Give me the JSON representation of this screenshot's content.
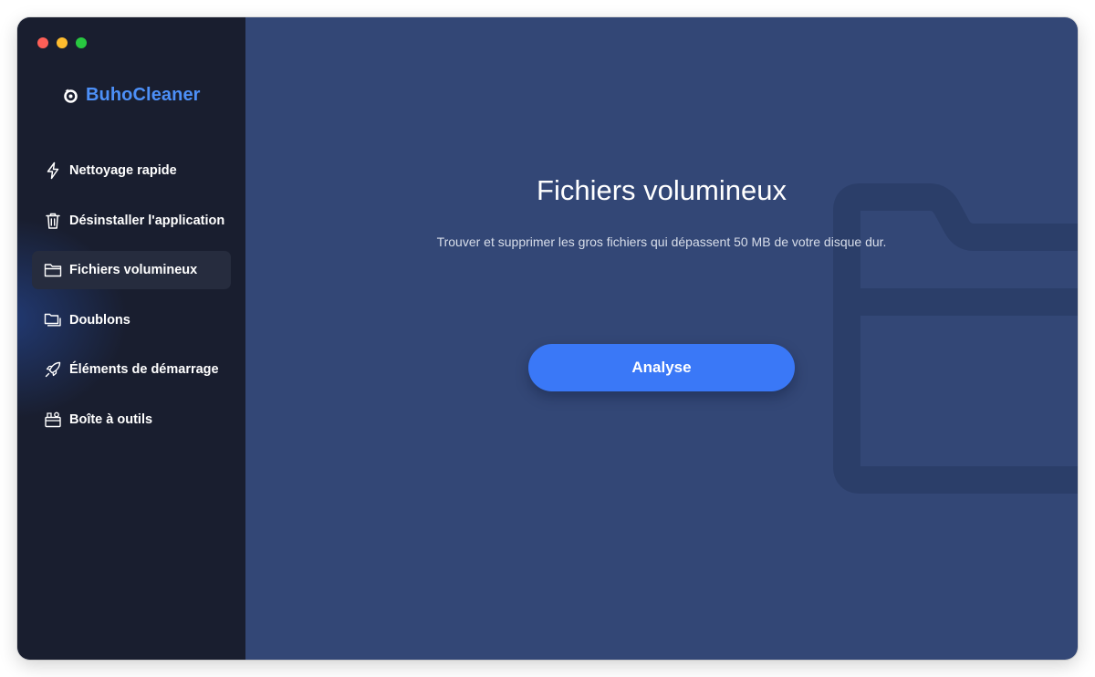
{
  "app": {
    "name": "BuhoCleaner"
  },
  "colors": {
    "accent": "#3a78f7",
    "brand": "#4d90f8",
    "sidebar_bg": "#191e2f",
    "main_bg": "#334776"
  },
  "sidebar": {
    "items": [
      {
        "label": "Nettoyage rapide",
        "icon": "lightning-icon",
        "active": false
      },
      {
        "label": "Désinstaller l'application",
        "icon": "trash-icon",
        "active": false
      },
      {
        "label": "Fichiers volumineux",
        "icon": "folder-icon",
        "active": true
      },
      {
        "label": "Doublons",
        "icon": "duplicate-folder-icon",
        "active": false
      },
      {
        "label": "Éléments de démarrage",
        "icon": "rocket-icon",
        "active": false
      },
      {
        "label": "Boîte à outils",
        "icon": "toolbox-icon",
        "active": false
      }
    ]
  },
  "main": {
    "title": "Fichiers volumineux",
    "subtitle": "Trouver et supprimer les gros fichiers qui dépassent 50 MB de votre disque dur.",
    "scan_button": "Analyse"
  }
}
